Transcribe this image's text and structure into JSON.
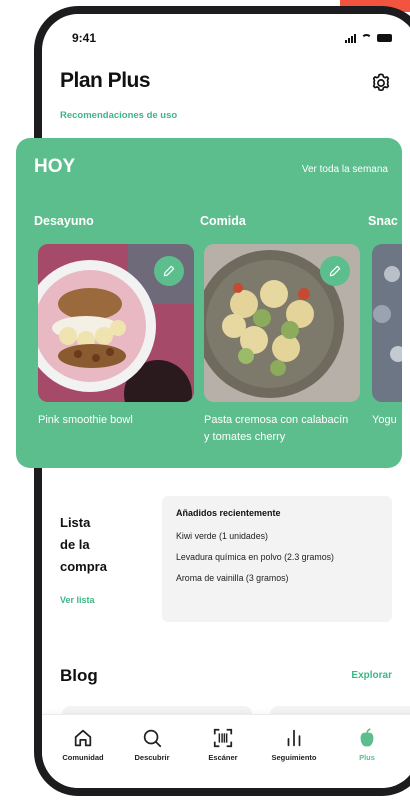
{
  "status_bar": {
    "time": "9:41"
  },
  "header": {
    "title": "Plan Plus",
    "subtitle_link": "Recomendaciones de uso"
  },
  "today": {
    "heading": "HOY",
    "week_link": "Ver toda la semana",
    "meals": [
      {
        "label": "Desayuno",
        "name": "Pink smoothie bowl"
      },
      {
        "label": "Comida",
        "name": "Pasta cremosa con calabacín y tomates cherry"
      },
      {
        "label": "Snac",
        "name": "Yogu"
      }
    ]
  },
  "shopping": {
    "title_line1": "Lista",
    "title_line2": "de la",
    "title_line3": "compra",
    "link": "Ver lista",
    "recent_heading": "Añadidos recientemente",
    "items": [
      "Kiwi verde (1 unidades)",
      "Levadura química en polvo (2.3 gramos)",
      "Aroma de vainilla (3 gramos)"
    ]
  },
  "blog": {
    "title": "Blog",
    "link": "Explorar"
  },
  "tabs": [
    {
      "label": "Comunidad",
      "icon": "home-icon"
    },
    {
      "label": "Descubrir",
      "icon": "search-icon"
    },
    {
      "label": "Escáner",
      "icon": "barcode-scanner-icon"
    },
    {
      "label": "Seguimiento",
      "icon": "bar-chart-icon"
    },
    {
      "label": "Plus",
      "icon": "apple-icon",
      "active": true
    }
  ],
  "colors": {
    "accent": "#5cbe8d",
    "link": "#3cb787",
    "corner": "#f2543f"
  }
}
